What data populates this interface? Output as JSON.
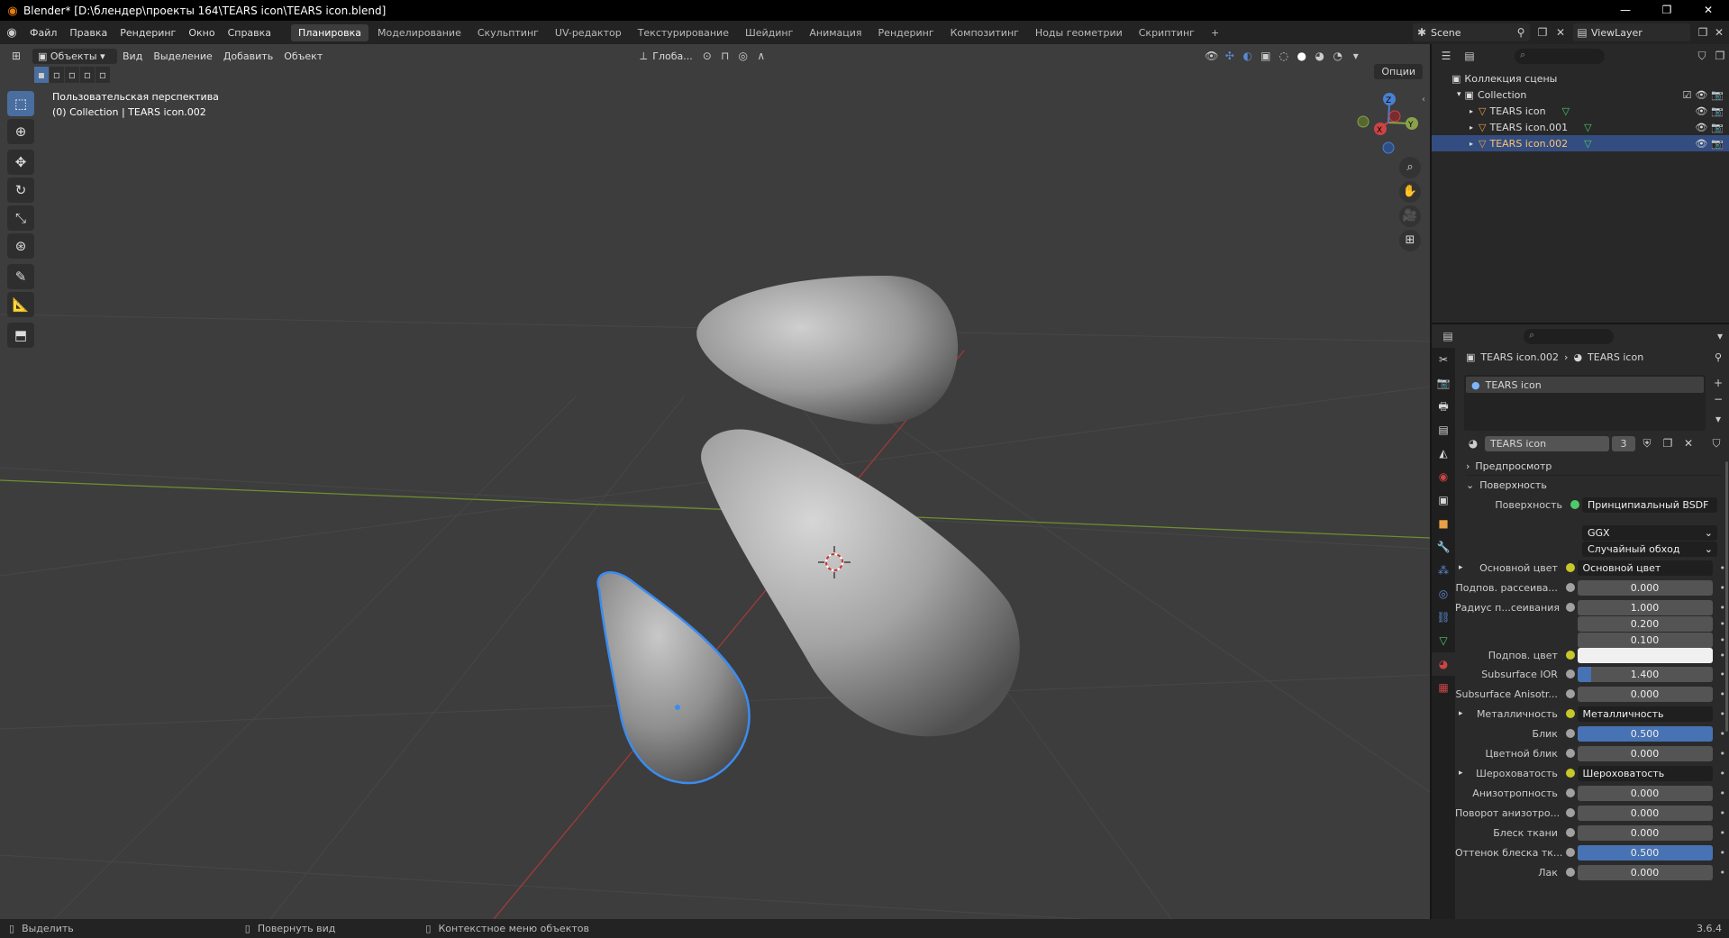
{
  "window": {
    "title": "Blender* [D:\\блендер\\проекты 164\\TEARS icon\\TEARS icon.blend]",
    "minimize": "—",
    "maximize": "❐",
    "close": "✕"
  },
  "menu": {
    "items": [
      "Файл",
      "Правка",
      "Рендеринг",
      "Окно",
      "Справка"
    ]
  },
  "workspaces": [
    "Планировка",
    "Моделирование",
    "Скульптинг",
    "UV-редактор",
    "Текстурирование",
    "Шейдинг",
    "Анимация",
    "Рендеринг",
    "Композитинг",
    "Ноды геометрии",
    "Скриптинг"
  ],
  "workspace_add": "+",
  "scene": {
    "name": "Scene",
    "view_layer": "ViewLayer"
  },
  "viewport": {
    "mode": "Объекты",
    "menus": [
      "Вид",
      "Выделение",
      "Добавить",
      "Объект"
    ],
    "transform_orientation": "Глоба...",
    "options_label": "Опции",
    "info_line1": "Пользовательская перспектива",
    "info_line2": "(0) Collection | TEARS icon.002",
    "gizmo": {
      "x": "X",
      "y": "Y",
      "z": "Z"
    }
  },
  "outliner": {
    "root": "Коллекция сцены",
    "collection": "Collection",
    "objects": [
      "TEARS icon",
      "TEARS icon.001",
      "TEARS icon.002"
    ],
    "selected_index": 2
  },
  "properties": {
    "breadcrumb_object": "TEARS icon.002",
    "breadcrumb_material": "TEARS icon",
    "slot_name": "TEARS icon",
    "material_name": "TEARS icon",
    "users": "3",
    "panel_preview": "Предпросмотр",
    "panel_surface": "Поверхность",
    "surface_label": "Поверхность",
    "surface_value": "Принципиальный BSDF",
    "distribution": "GGX",
    "subsurface_method": "Случайный обход",
    "rows": [
      {
        "label": "Основной цвет",
        "value": "Основной цвет",
        "kind": "node"
      },
      {
        "label": "Подпов. рассеива...",
        "value": "0.000",
        "kind": "num",
        "fill": 0
      },
      {
        "label": "Радиус п...сеивания",
        "value": "1.000",
        "kind": "num",
        "fill": 0
      },
      {
        "label": "",
        "value": "0.200",
        "kind": "num",
        "fill": 0
      },
      {
        "label": "",
        "value": "0.100",
        "kind": "num",
        "fill": 0
      },
      {
        "label": "Подпов. цвет",
        "value": "",
        "kind": "color",
        "color": "#f0f0f0"
      },
      {
        "label": "Subsurface IOR",
        "value": "1.400",
        "kind": "num",
        "fill": 0.1
      },
      {
        "label": "Subsurface Anisotr...",
        "value": "0.000",
        "kind": "num",
        "fill": 0
      },
      {
        "label": "Металличность",
        "value": "Металличность",
        "kind": "node"
      },
      {
        "label": "Блик",
        "value": "0.500",
        "kind": "num",
        "fill": 1
      },
      {
        "label": "Цветной блик",
        "value": "0.000",
        "kind": "num",
        "fill": 0
      },
      {
        "label": "Шероховатость",
        "value": "Шероховатость",
        "kind": "node"
      },
      {
        "label": "Анизотропность",
        "value": "0.000",
        "kind": "num",
        "fill": 0
      },
      {
        "label": "Поворот анизотро...",
        "value": "0.000",
        "kind": "num",
        "fill": 0
      },
      {
        "label": "Блеск ткани",
        "value": "0.000",
        "kind": "num",
        "fill": 0
      },
      {
        "label": "Оттенок блеска тк...",
        "value": "0.500",
        "kind": "num",
        "fill": 1
      },
      {
        "label": "Лак",
        "value": "0.000",
        "kind": "num",
        "fill": 0
      }
    ]
  },
  "statusbar": {
    "select": "Выделить",
    "rotate": "Повернуть вид",
    "context": "Контекстное меню объектов",
    "version": "3.6.4"
  },
  "colors": {
    "accent": "#4772b3",
    "selection": "#334d80",
    "x_axis": "#a83a3a",
    "y_axis": "#6f8f2f",
    "outline": "#3a8cf0"
  }
}
